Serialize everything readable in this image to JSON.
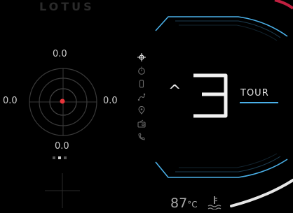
{
  "brand": "LOTUS",
  "g_meter": {
    "top": "0.0",
    "left": "0.0",
    "right": "0.0",
    "bottom": "0.0"
  },
  "pager": {
    "count": 3,
    "active": 1
  },
  "icons": [
    "crosshair-icon",
    "stopwatch-icon",
    "phone-device-icon",
    "route-icon",
    "location-pin-icon",
    "radio-icon",
    "phone-call-icon"
  ],
  "gear": {
    "direction_symbol": "^",
    "number": "3",
    "mode": "TOUR"
  },
  "temperature": {
    "value": "87",
    "unit": "°C"
  },
  "colors": {
    "accent_blue": "#4ab0e8",
    "red_dot": "#e8343a",
    "gauge_white": "#e6e6e6",
    "corner_red": "#c02040"
  }
}
